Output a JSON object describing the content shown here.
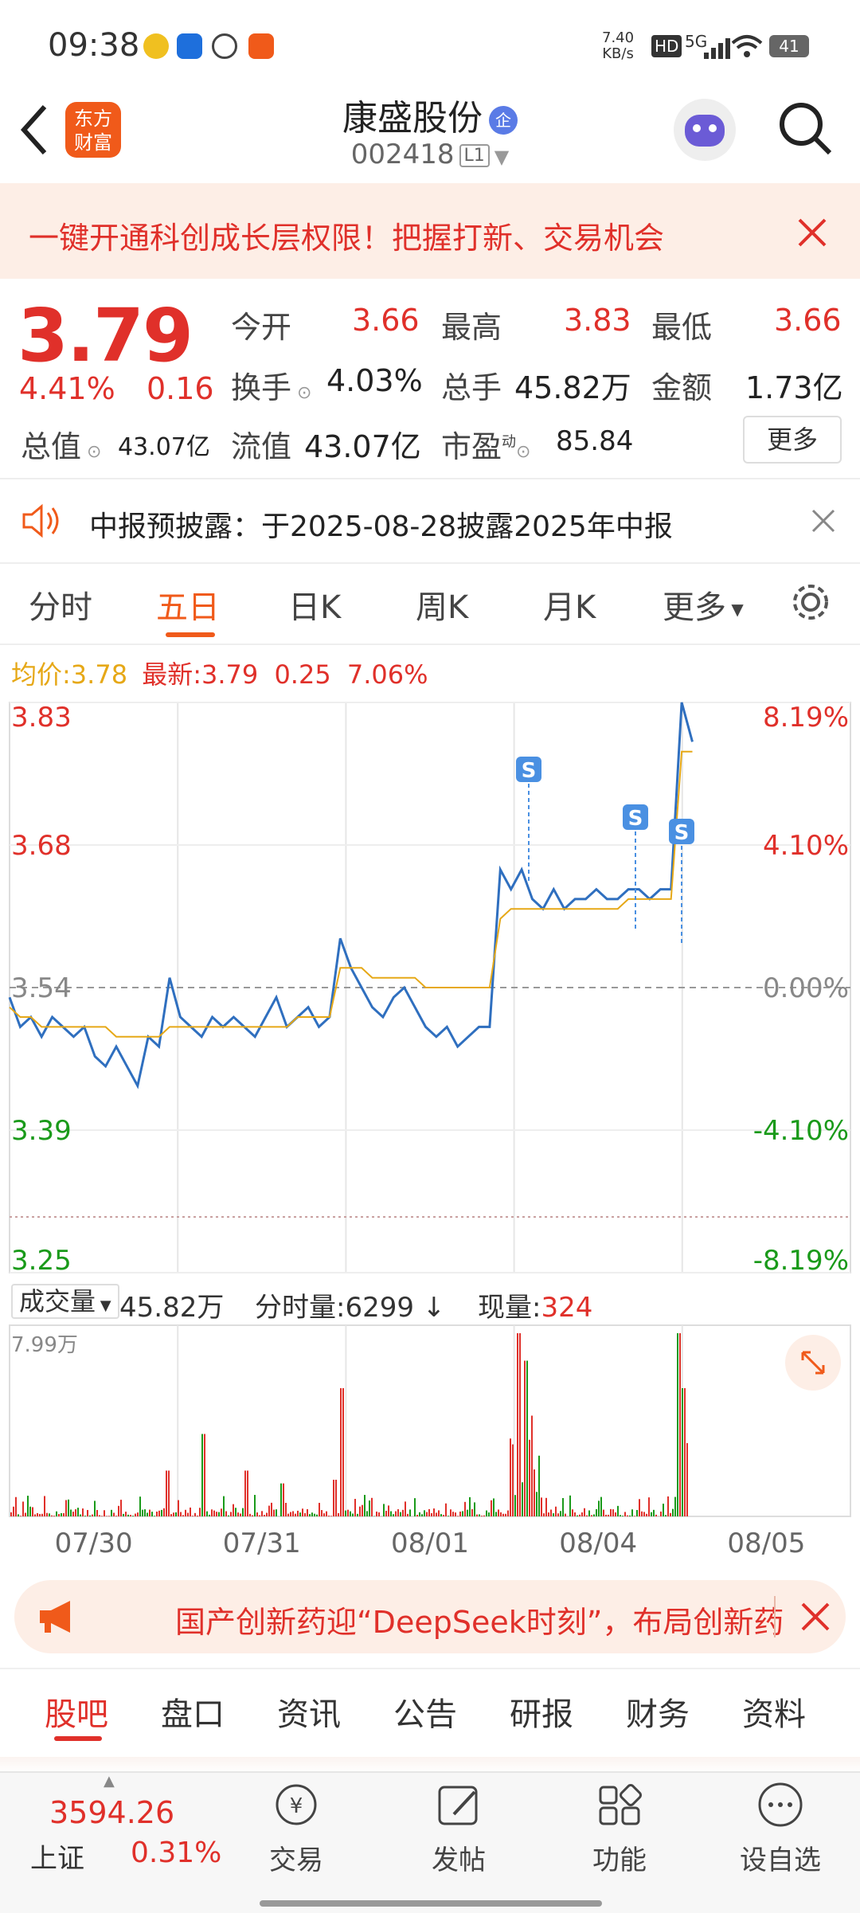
{
  "status_bar": {
    "time": "09:38",
    "net_speed_value": "7.40",
    "net_speed_unit": "KB/s",
    "hd": "HD",
    "signal": "5G",
    "battery": "41"
  },
  "header": {
    "logo_line1": "东方",
    "logo_line2": "财富",
    "title": "康盛股份",
    "title_badge": "企",
    "code": "002418",
    "level": "L1"
  },
  "banner": {
    "text": "一键开通科创成长层权限！把握打新、交易机会"
  },
  "quote": {
    "price": "3.79",
    "change_pct": "4.41%",
    "change": "0.16",
    "open_label": "今开",
    "open": "3.66",
    "high_label": "最高",
    "high": "3.83",
    "low_label": "最低",
    "low": "3.66",
    "turnover_label": "换手",
    "turnover": "4.03%",
    "volume_label": "总手",
    "volume": "45.82万",
    "amount_label": "金额",
    "amount": "1.73亿",
    "mktcap_label": "总值",
    "mktcap": "43.07亿",
    "float_label": "流值",
    "float": "43.07亿",
    "pe_label": "市盈",
    "pe_sup": "动",
    "pe": "85.84",
    "more": "更多"
  },
  "notice": {
    "text": "中报预披露：于2025-08-28披露2025年中报"
  },
  "chart_tabs": [
    "分时",
    "五日",
    "日K",
    "周K",
    "月K",
    "更多"
  ],
  "legend": {
    "avg_label": "均价:",
    "avg": "3.78",
    "latest_label": "最新:",
    "latest": "3.79",
    "change": "0.25",
    "pct": "7.06%"
  },
  "chart_data": {
    "type": "line",
    "x": [
      "07/30",
      "07/31",
      "08/01",
      "08/04",
      "08/05"
    ],
    "y_labels_left": [
      "3.83",
      "3.68",
      "3.54",
      "3.39",
      "3.25"
    ],
    "y_labels_right": [
      "8.19%",
      "4.10%",
      "0.00%",
      "-4.10%",
      "-8.19%"
    ],
    "ylim": [
      3.25,
      3.83
    ],
    "series": [
      {
        "name": "",
        "color": "#2f6fbf",
        "values": [
          3.53,
          3.5,
          3.51,
          3.49,
          3.51,
          3.5,
          3.49,
          3.5,
          3.47,
          3.46,
          3.48,
          3.46,
          3.44,
          3.49,
          3.48,
          3.55,
          3.51,
          3.5,
          3.49,
          3.51,
          3.5,
          3.51,
          3.5,
          3.49,
          3.51,
          3.53,
          3.5,
          3.51,
          3.52,
          3.5,
          3.51,
          3.59,
          3.56,
          3.54,
          3.52,
          3.51,
          3.53,
          3.54,
          3.52,
          3.5,
          3.49,
          3.5,
          3.48,
          3.49,
          3.5,
          3.5,
          3.66,
          3.64,
          3.66,
          3.63,
          3.62,
          3.64,
          3.62,
          3.63,
          3.63,
          3.64,
          3.63,
          3.63,
          3.64,
          3.64,
          3.63,
          3.64,
          3.64,
          3.83,
          3.79
        ]
      },
      {
        "name": "",
        "color": "#e6a817",
        "values": [
          3.52,
          3.51,
          3.51,
          3.5,
          3.5,
          3.5,
          3.5,
          3.5,
          3.5,
          3.5,
          3.49,
          3.49,
          3.49,
          3.49,
          3.49,
          3.5,
          3.5,
          3.5,
          3.5,
          3.5,
          3.5,
          3.5,
          3.5,
          3.5,
          3.5,
          3.5,
          3.5,
          3.51,
          3.51,
          3.51,
          3.51,
          3.56,
          3.56,
          3.56,
          3.55,
          3.55,
          3.55,
          3.55,
          3.55,
          3.54,
          3.54,
          3.54,
          3.54,
          3.54,
          3.54,
          3.54,
          3.61,
          3.62,
          3.62,
          3.62,
          3.62,
          3.62,
          3.62,
          3.62,
          3.62,
          3.62,
          3.62,
          3.62,
          3.63,
          3.63,
          3.63,
          3.63,
          3.63,
          3.78,
          3.78
        ]
      }
    ],
    "volume_max_label": "7.99万"
  },
  "volume_bar": {
    "label": "成交量",
    "total": "45.82万",
    "period_label": "分时量:",
    "period": "6299",
    "now_label": "现量:",
    "now": "324"
  },
  "promo": {
    "text": "国产创新药迎“DeepSeek时刻”，布局创新药"
  },
  "bottom_tabs": [
    "股吧",
    "盘口",
    "资讯",
    "公告",
    "研报",
    "财务",
    "资料"
  ],
  "bottom_bar": {
    "index_value": "3594.26",
    "index_name": "上证",
    "index_pct": "0.31%",
    "trade": "交易",
    "post": "发帖",
    "func": "功能",
    "watch": "设自选"
  },
  "colors": {
    "up": "#e0302a",
    "down": "#1a9a1a",
    "accent": "#f05a1a",
    "line": "#2f6fbf",
    "avg": "#e6a817"
  }
}
